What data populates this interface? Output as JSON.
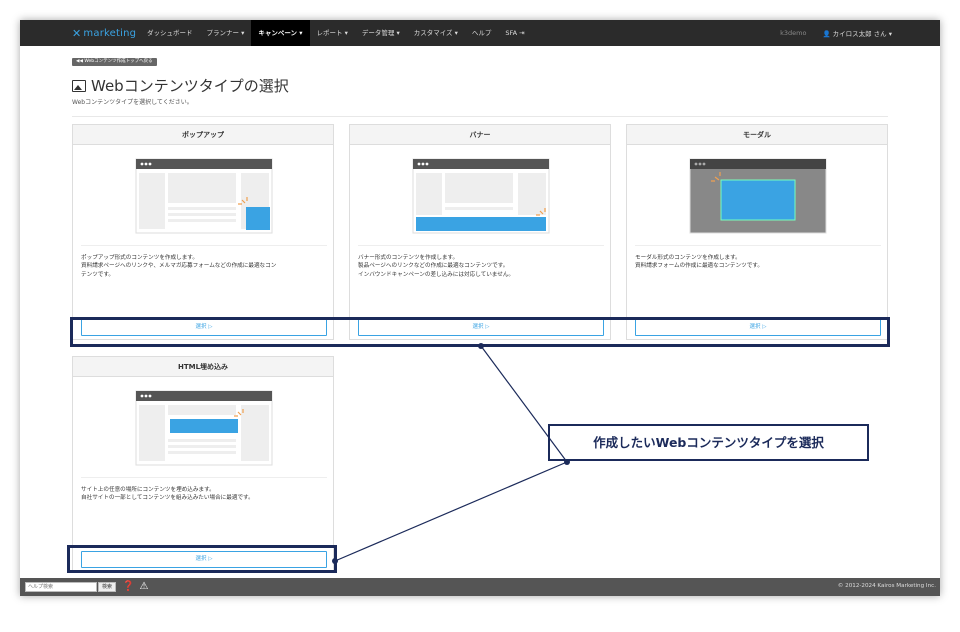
{
  "navbar": {
    "logo_text": "marketing",
    "items": [
      "ダッシュボード",
      "プランナー ▾",
      "キャンペーン ▾",
      "レポート ▾",
      "データ管理 ▾",
      "カスタマイズ ▾",
      "ヘルプ",
      "SFA ⇥"
    ],
    "account": "k3demo",
    "user": "👤 カイロス太郎 さん ▾"
  },
  "page": {
    "back_label": "◀◀ Webコンテンツ作成トップへ戻る",
    "title": "Webコンテンツタイプの選択",
    "subtitle": "Webコンテンツタイプを選択してください。"
  },
  "cards": [
    {
      "title": "ポップアップ",
      "desc": [
        "ポップアップ形式のコンテンツを作成します。",
        "資料請求ページへのリンクや、メルマガ応募フォームなどの作成に最適なコン",
        "テンツです。"
      ],
      "button": "選択 ▷"
    },
    {
      "title": "バナー",
      "desc": [
        "バナー形式のコンテンツを作成します。",
        "製品ページへのリンクなどの作成に最適なコンテンツです。",
        "インバウンドキャンペーンの差し込みには対応していません。"
      ],
      "button": "選択 ▷"
    },
    {
      "title": "モーダル",
      "desc": [
        "モーダル形式のコンテンツを作成します。",
        "資料請求フォームの作成に最適なコンテンツです。"
      ],
      "button": "選択 ▷"
    },
    {
      "title": "HTML埋め込み",
      "desc": [
        "サイト上の任意の場所にコンテンツを埋め込みます。",
        "自社サイトの一部としてコンテンツを組み込みたい場合に最適です。"
      ],
      "button": "選択 ▷"
    }
  ],
  "footer": {
    "help_placeholder": "ヘルプ検索",
    "help_button": "検索",
    "copyright": "© 2012-2024 Kairos Marketing Inc."
  },
  "callout": "作成したいWebコンテンツタイプを選択",
  "colors": {
    "accent": "#3aa3e3",
    "annotation": "#1b2a5a",
    "navbar": "#2b2b2b"
  }
}
